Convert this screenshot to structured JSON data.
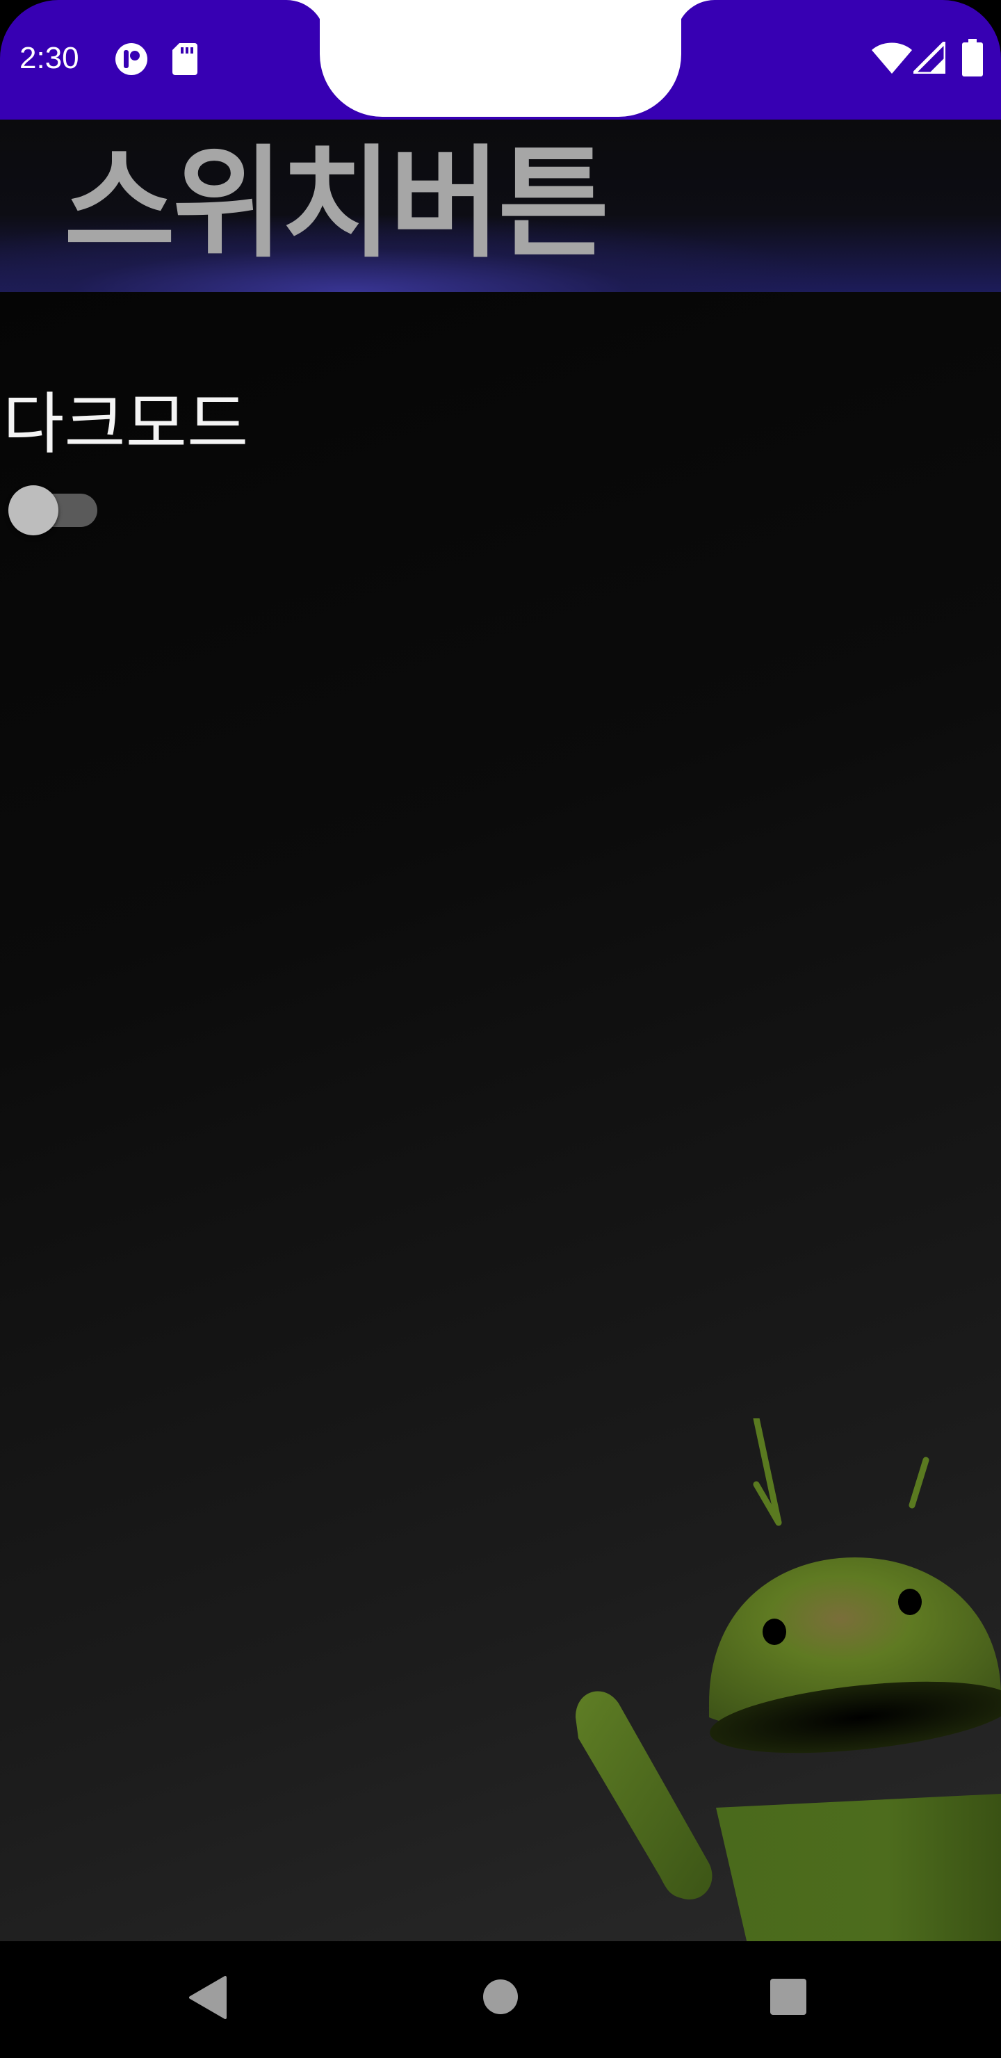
{
  "status_bar": {
    "time": "2:30",
    "background": "#3700b3",
    "icons": [
      "notification-app-icon",
      "sd-card-icon",
      "wifi-icon",
      "cellular-signal-icon",
      "battery-icon"
    ]
  },
  "app_bar": {
    "title": "스위치버튼",
    "title_color": "#a6a6a6"
  },
  "content": {
    "switch_label": "다크모드",
    "switch_checked": false,
    "illustration": "android-robot-illustration"
  },
  "nav_bar": {
    "buttons": [
      "back-icon",
      "home-icon",
      "recents-icon"
    ],
    "icon_color": "#9e9e9e"
  }
}
